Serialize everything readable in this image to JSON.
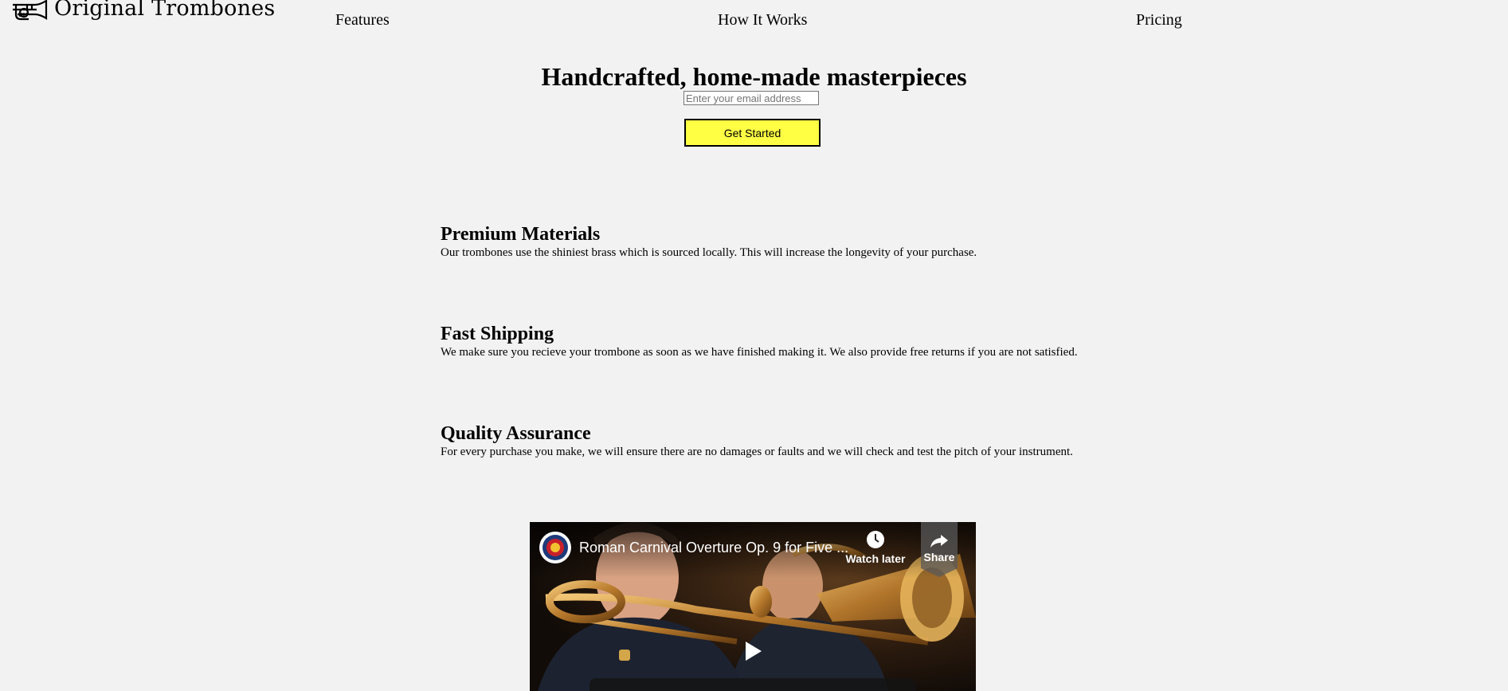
{
  "header": {
    "brand": "Original Trombones",
    "logo_icon": "trombone-logo-icon",
    "nav": [
      {
        "label": "Features"
      },
      {
        "label": "How It Works"
      },
      {
        "label": "Pricing"
      }
    ]
  },
  "hero": {
    "title": "Handcrafted, home-made masterpieces",
    "email_placeholder": "Enter your email address",
    "email_value": "",
    "cta_label": "Get Started",
    "cta_color": "#ffff44"
  },
  "features": [
    {
      "title": "Premium Materials",
      "text": "Our trombones use the shiniest brass which is sourced locally. This will increase the longevity of your purchase."
    },
    {
      "title": "Fast Shipping",
      "text": "We make sure you recieve your trombone as soon as we have finished making it. We also provide free returns if you are not satisfied."
    },
    {
      "title": "Quality Assurance",
      "text": "For every purchase you make, we will ensure there are no damages or faults and we will check and test the pitch of your instrument."
    }
  ],
  "video": {
    "title": "Roman Carnival Overture Op. 9 for Five ...",
    "watch_later_label": "Watch later",
    "share_label": "Share",
    "icons": {
      "watch_later": "clock-icon",
      "share": "share-arrow-icon",
      "play": "play-icon",
      "channel": "channel-avatar-icon"
    }
  },
  "colors": {
    "background": "#f2f2f2",
    "text": "#000000",
    "button": "#ffff44"
  }
}
